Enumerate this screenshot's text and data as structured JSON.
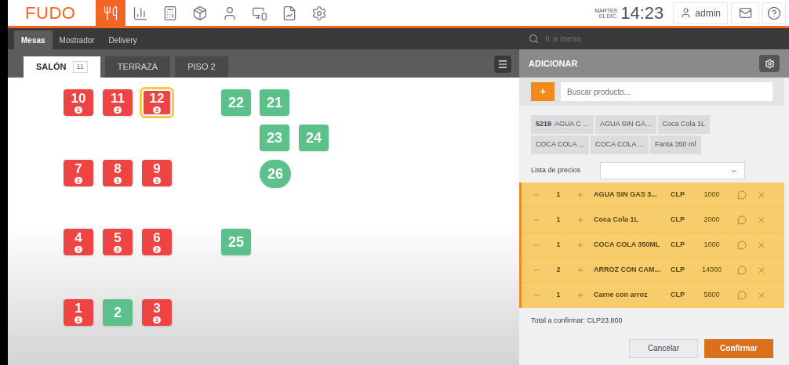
{
  "header": {
    "logo": "FUDO",
    "nav_icons": [
      {
        "kind": "utensils",
        "selected": true
      },
      {
        "kind": "chart",
        "selected": false
      },
      {
        "kind": "calculator",
        "selected": false
      },
      {
        "kind": "products",
        "selected": false
      },
      {
        "kind": "user",
        "selected": false
      },
      {
        "kind": "devices",
        "selected": false
      },
      {
        "kind": "report",
        "selected": false
      },
      {
        "kind": "settings",
        "selected": false
      }
    ],
    "day": "MARTES",
    "date": "01 DIC.",
    "time": "14:23",
    "user": "admin"
  },
  "mode_tabs": [
    {
      "label": "Mesas",
      "selected": true
    },
    {
      "label": "Mostrador",
      "selected": false
    },
    {
      "label": "Delivery",
      "selected": false
    }
  ],
  "table_search": {
    "placeholder": "Ir a mesa"
  },
  "room_tabs": [
    {
      "label": "SALÓN",
      "count": "11",
      "selected": true
    },
    {
      "label": "TERRAZA",
      "selected": false
    },
    {
      "label": "PISO 2",
      "selected": false
    }
  ],
  "tables": [
    {
      "number": "10",
      "occupied": true,
      "guests": "1",
      "round": false,
      "selected": false
    },
    {
      "number": "11",
      "occupied": true,
      "guests": "2",
      "round": false,
      "selected": false
    },
    {
      "number": "12",
      "occupied": true,
      "guests": "3",
      "round": false,
      "selected": true
    },
    {
      "number": "22",
      "occupied": false,
      "round": false,
      "selected": false
    },
    {
      "number": "21",
      "occupied": false,
      "round": false,
      "selected": false
    },
    {
      "number": "23",
      "occupied": false,
      "round": false,
      "selected": false
    },
    {
      "number": "24",
      "occupied": false,
      "round": false,
      "selected": false
    },
    {
      "number": "7",
      "occupied": true,
      "guests": "1",
      "round": false,
      "selected": false
    },
    {
      "number": "8",
      "occupied": true,
      "guests": "1",
      "round": false,
      "selected": false
    },
    {
      "number": "9",
      "occupied": true,
      "guests": "1",
      "round": false,
      "selected": false
    },
    {
      "number": "26",
      "occupied": false,
      "round": true,
      "selected": false
    },
    {
      "number": "4",
      "occupied": true,
      "guests": "1",
      "round": false,
      "selected": false
    },
    {
      "number": "5",
      "occupied": true,
      "guests": "2",
      "round": false,
      "selected": false
    },
    {
      "number": "6",
      "occupied": true,
      "guests": "2",
      "round": false,
      "selected": false
    },
    {
      "number": "25",
      "occupied": false,
      "round": false,
      "selected": false
    },
    {
      "number": "1",
      "occupied": true,
      "guests": "1",
      "round": false,
      "selected": false
    },
    {
      "number": "2",
      "occupied": false,
      "round": false,
      "selected": false
    },
    {
      "number": "3",
      "occupied": true,
      "guests": "1",
      "round": false,
      "selected": false
    }
  ],
  "order_panel": {
    "title": "ADICIONAR",
    "add_button": "+",
    "search": {
      "placeholder": "Buscar producto..."
    },
    "quick_products": [
      {
        "code": "5219",
        "name": "AGUA C ..."
      },
      {
        "name": "AGUA SIN GA..."
      },
      {
        "name": "Coca Cola 1L"
      },
      {
        "name": "COCA COLA ..."
      },
      {
        "name": "COCA COLA ..."
      },
      {
        "name": "Fanta 350 ml"
      }
    ],
    "price_list_label": "Lista de precios",
    "items": [
      {
        "qty": "1",
        "name": "AGUA SIN GAS 3...",
        "currency": "CLP",
        "price": "1000"
      },
      {
        "qty": "1",
        "name": "Coca Cola 1L",
        "currency": "CLP",
        "price": "2000"
      },
      {
        "qty": "1",
        "name": "COCA COLA 350ML",
        "currency": "CLP",
        "price": "1000"
      },
      {
        "qty": "2",
        "name": "ARROZ CON CAM...",
        "currency": "CLP",
        "price": "14000"
      },
      {
        "qty": "1",
        "name": "Carne con arroz",
        "currency": "CLP",
        "price": "5800"
      }
    ],
    "total": "Total a confirmar: CLP23.800",
    "buttons": [
      "Cancelar",
      "Confirmar"
    ]
  }
}
